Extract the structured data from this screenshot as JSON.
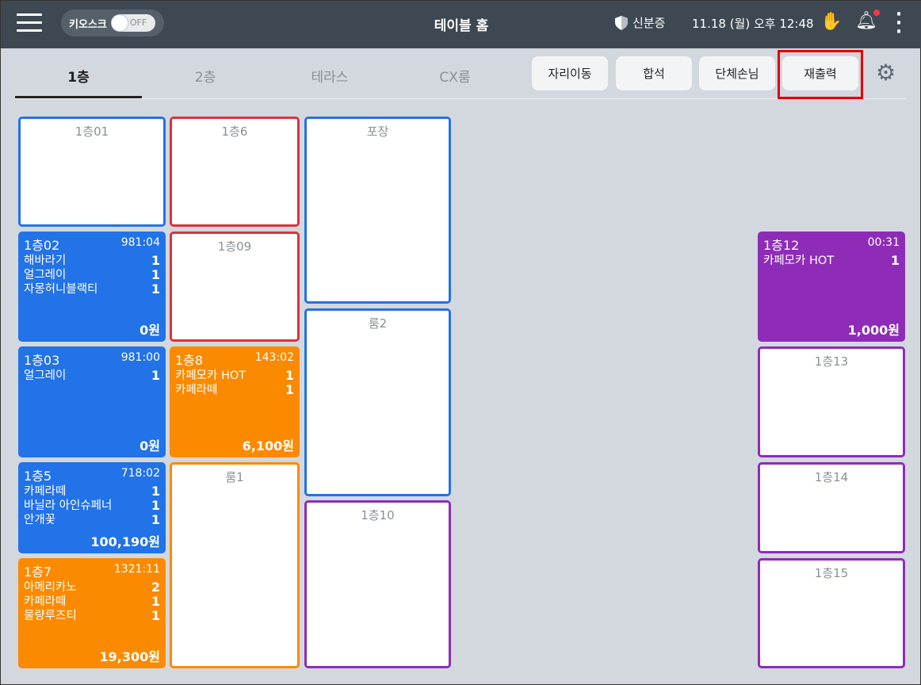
{
  "header": {
    "title": "테이블 홈",
    "kiosk_label": "키오스크",
    "kiosk_toggle": "OFF",
    "id_check": "신분증",
    "datetime": "11.18 (월) 오후 12:48"
  },
  "tabs": [
    {
      "label": "1층",
      "active": true
    },
    {
      "label": "2층"
    },
    {
      "label": "테라스"
    },
    {
      "label": "CX룸"
    }
  ],
  "actions": {
    "move": "자리이동",
    "merge": "합석",
    "group": "단체손님",
    "reprint": "재출력"
  },
  "colors": {
    "blue": "#2272e8",
    "orange": "#fb8a00",
    "red": "#e0303c",
    "purple": "#8e2cb8",
    "header": "#3d4853"
  },
  "tables": [
    {
      "name": "1층01",
      "color": "blue"
    },
    {
      "name": "1층02",
      "color": "blue",
      "time": "981:04",
      "items": [
        {
          "n": "해바라기",
          "q": "1"
        },
        {
          "n": "얼그레이",
          "q": "1"
        },
        {
          "n": "자몽허니블랙티",
          "q": "1"
        }
      ],
      "total": "0원"
    },
    {
      "name": "1층03",
      "color": "blue",
      "time": "981:00",
      "items": [
        {
          "n": "얼그레이",
          "q": "1"
        }
      ],
      "total": "0원"
    },
    {
      "name": "1층5",
      "color": "blue",
      "time": "718:02",
      "items": [
        {
          "n": "카페라떼",
          "q": "1"
        },
        {
          "n": "바닐라 아인슈페너",
          "q": "1"
        },
        {
          "n": "안개꽃",
          "q": "1"
        }
      ],
      "total": "100,190원"
    },
    {
      "name": "1층7",
      "color": "orange",
      "time": "1321:11",
      "items": [
        {
          "n": "아메리카노",
          "q": "2"
        },
        {
          "n": "카페라떼",
          "q": "1"
        },
        {
          "n": "물량루즈티",
          "q": "1"
        }
      ],
      "total": "19,300원"
    },
    {
      "name": "1층6",
      "color": "red"
    },
    {
      "name": "1층09",
      "color": "red"
    },
    {
      "name": "1층8",
      "color": "orange",
      "time": "143:02",
      "items": [
        {
          "n": "카페모카 HOT",
          "q": "1"
        },
        {
          "n": "카페라떼",
          "q": "1"
        }
      ],
      "total": "6,100원"
    },
    {
      "name": "룸1",
      "color": "orange"
    },
    {
      "name": "포장",
      "color": "blue"
    },
    {
      "name": "룸2",
      "color": "blue"
    },
    {
      "name": "1층10",
      "color": "purple"
    },
    {
      "name": "1층12",
      "color": "purple",
      "time": "00:31",
      "items": [
        {
          "n": "카페모카 HOT",
          "q": "1"
        }
      ],
      "total": "1,000원"
    },
    {
      "name": "1층13",
      "color": "purple"
    },
    {
      "name": "1층14",
      "color": "purple"
    },
    {
      "name": "1층15",
      "color": "purple"
    }
  ]
}
